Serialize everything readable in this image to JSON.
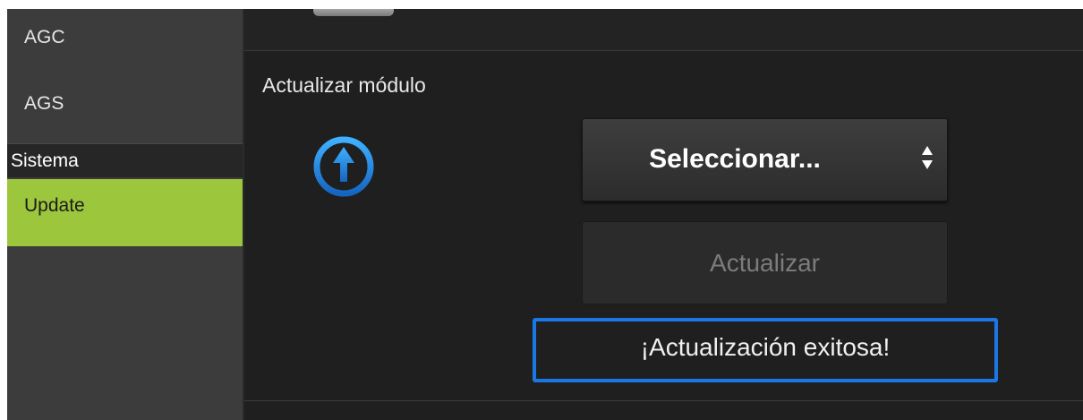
{
  "sidebar": {
    "items": [
      {
        "label": "AGC"
      },
      {
        "label": "AGS"
      }
    ],
    "section_header": "Sistema",
    "active_item": {
      "label": "Update"
    }
  },
  "main": {
    "section_title": "Actualizar módulo",
    "icon": "upload-arrow-circle-icon",
    "select": {
      "selected_value": "Seleccionar...",
      "arrows_icon": "select-updown-arrows-icon"
    },
    "update_button": {
      "label": "Actualizar",
      "state": "disabled"
    },
    "status_message": "¡Actualización exitosa!"
  },
  "colors": {
    "sidebar_bg": "#3c3c3c",
    "active_green": "#9cc63c",
    "main_bg": "#1f1f1f",
    "status_border": "#1a78e6",
    "icon_blue": "#1e88e5"
  }
}
